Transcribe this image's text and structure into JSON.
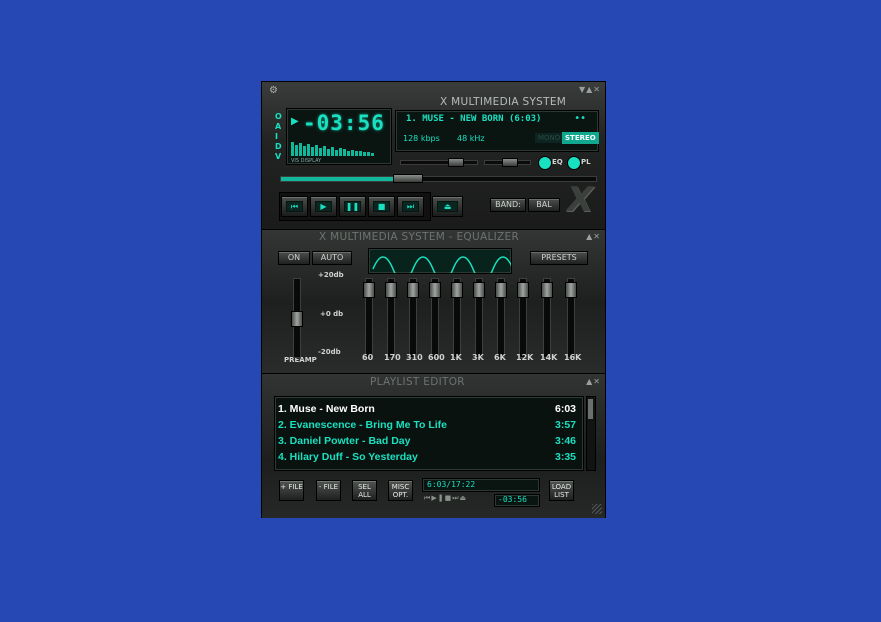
{
  "main": {
    "title": "X MULTIMEDIA SYSTEM",
    "side_label": "OAIDV",
    "time": "-03:56",
    "vis_label": "VIS DISPLAY",
    "track": "1. MUSE - NEW BORN (6:03)",
    "track_dots": "••",
    "bitrate": "128 kbps",
    "samplerate": "48 kHz",
    "mono_label": "MONO",
    "stereo_label": "STEREO",
    "eq_toggle": "EQ",
    "pl_toggle": "PL",
    "band_label": "BAND:",
    "bal_label": "BAL",
    "logo": "X",
    "seek_position": 0.38,
    "volume": 0.62,
    "balance": 0.55
  },
  "equalizer": {
    "title": "X MULTIMEDIA SYSTEM - EQUALIZER",
    "on_label": "ON",
    "auto_label": "AUTO",
    "presets_label": "PRESETS",
    "db_top": "+20db",
    "db_mid": "+0 db",
    "db_bot": "-20db",
    "preamp_label": "PREAMP",
    "preamp_level": 0.5,
    "bands": [
      {
        "label": "60",
        "level": 0.95
      },
      {
        "label": "170",
        "level": 0.95
      },
      {
        "label": "310",
        "level": 0.95
      },
      {
        "label": "600",
        "level": 0.95
      },
      {
        "label": "1K",
        "level": 0.95
      },
      {
        "label": "3K",
        "level": 0.95
      },
      {
        "label": "6K",
        "level": 0.95
      },
      {
        "label": "12K",
        "level": 0.95
      },
      {
        "label": "14K",
        "level": 0.95
      },
      {
        "label": "16K",
        "level": 0.95
      }
    ]
  },
  "playlist": {
    "title": "PLAYLIST EDITOR",
    "items": [
      {
        "title": "1. Muse - New Born",
        "duration": "6:03",
        "active": true
      },
      {
        "title": "2. Evanescence - Bring Me To Life",
        "duration": "3:57",
        "active": false
      },
      {
        "title": "3. Daniel Powter - Bad Day",
        "duration": "3:46",
        "active": false
      },
      {
        "title": "4. Hilary Duff - So Yesterday",
        "duration": "3:35",
        "active": false
      }
    ],
    "add_file": "+ FILE",
    "rem_file": "- FILE",
    "sel_all": "SEL ALL",
    "misc_opt": "MISC OPT.",
    "load_list": "LOAD LIST",
    "time_info": "6:03/17:22",
    "mini_time": "-03:56"
  },
  "colors": {
    "background": "#2548b5",
    "lcd_text": "#19e0c0",
    "playlist_active": "#ffffff",
    "playlist_text": "#19e0c0"
  }
}
